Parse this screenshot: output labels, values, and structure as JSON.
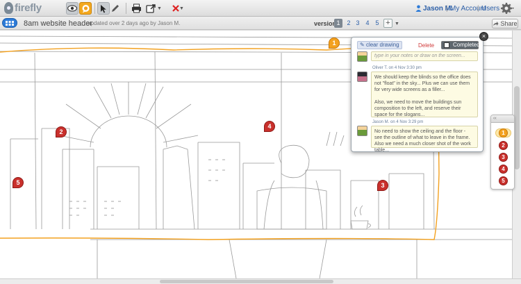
{
  "app": {
    "logo_text": "firefly"
  },
  "toolbar": {
    "tools": [
      "eye-icon",
      "comment-icon",
      "pointer-icon",
      "pen-icon",
      "print-icon",
      "export-icon",
      "erase-icon"
    ],
    "accent_color": "#f3a11f"
  },
  "user": {
    "name": "Jason M.",
    "account_label": "My Account",
    "users_label": "Users"
  },
  "subheader": {
    "title": "8am website header",
    "updated": "updated over 2 days ago by Jason M.",
    "version_label": "version:",
    "versions": [
      "1",
      "2",
      "3",
      "4",
      "5"
    ],
    "active_version": "1",
    "add_label": "+",
    "share_label": "Share"
  },
  "pins": [
    "1",
    "2",
    "3",
    "4",
    "5"
  ],
  "popup": {
    "clear_label": "clear drawing",
    "delete_label": "Delete",
    "completed_label": "Completed",
    "note_placeholder": "type in your notes or draw on the screen...",
    "comments": [
      {
        "meta": "Oliver T. on 4 Nov 3:30 pm",
        "paragraphs": [
          "We should keep the blinds so the office does not \"float\" in the sky... Plus we can use them for very wide screens as a filler...",
          "Also, we need to move the buildings sun composition to the left, and reserve their space for the slogans..."
        ]
      },
      {
        "meta": "Jason M. on 4 Nov 3:29 pm",
        "paragraphs": [
          "No need to show the ceiling and the floor - see the outline of what to leave in the frame. Also we need a much closer shot of the work table..."
        ]
      }
    ]
  },
  "pinlist": {
    "collapse_label": "‹‹",
    "items": [
      "1",
      "2",
      "3",
      "4",
      "5"
    ]
  }
}
